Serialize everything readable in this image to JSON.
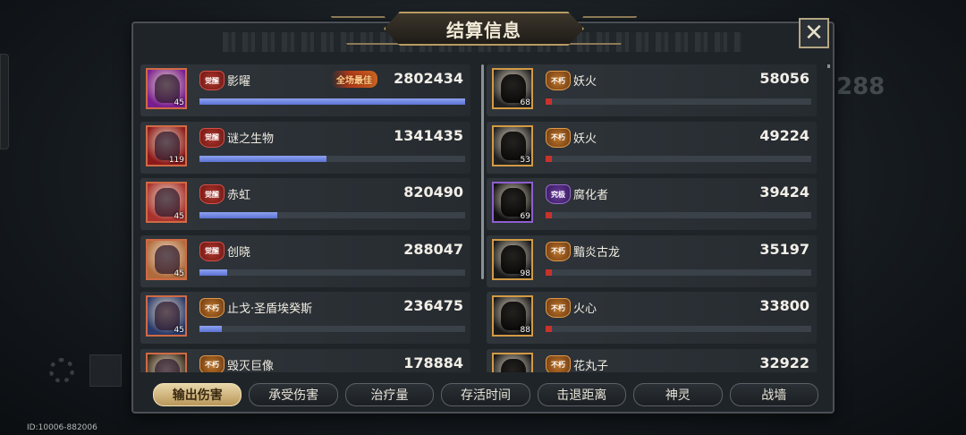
{
  "background": {
    "top_left_text": "",
    "top_right_text": "",
    "side_number": "288",
    "id_text": "ID:10006-882006"
  },
  "panel": {
    "title": "结算信息",
    "close_icon": "x-close-icon"
  },
  "colors": {
    "accent_gold": "#b89b63",
    "bar_blue": "#6f86e0",
    "bar_red": "#c8322d",
    "tab_active": "#d8bd84"
  },
  "left_team": [
    {
      "name": "影曜",
      "value": "2802434",
      "level": "45",
      "grade": "觉醒",
      "badge_color": "red",
      "avatar_color": "#7a1e8f",
      "mvp": "全场最佳",
      "share": 1.0
    },
    {
      "name": "谜之生物",
      "value": "1341435",
      "level": "119",
      "grade": "觉醒",
      "badge_color": "red",
      "avatar_color": "#8c1a1a",
      "mvp": "",
      "share": 0.4787
    },
    {
      "name": "赤虹",
      "value": "820490",
      "level": "45",
      "grade": "觉醒",
      "badge_color": "red",
      "avatar_color": "#a8322e",
      "mvp": "",
      "share": 0.2928
    },
    {
      "name": "创晓",
      "value": "288047",
      "level": "45",
      "grade": "觉醒",
      "badge_color": "red",
      "avatar_color": "#b06a3b",
      "mvp": "",
      "share": 0.1028
    },
    {
      "name": "止戈·圣盾埃癸斯",
      "value": "236475",
      "level": "45",
      "grade": "不朽",
      "badge_color": "gold",
      "avatar_color": "#2a3a6a",
      "mvp": "",
      "share": 0.0844
    },
    {
      "name": "毁灭巨像",
      "value": "178884",
      "level": "",
      "grade": "不朽",
      "badge_color": "gold",
      "avatar_color": "#3a2a1a",
      "mvp": "",
      "share": 0.0638
    }
  ],
  "right_team": [
    {
      "name": "妖火",
      "value": "58056",
      "level": "68",
      "grade": "不朽",
      "badge_color": "gold",
      "avatar_color": "#222",
      "share": 0.0207
    },
    {
      "name": "妖火",
      "value": "49224",
      "level": "53",
      "grade": "不朽",
      "badge_color": "gold",
      "avatar_color": "#222",
      "share": 0.0176
    },
    {
      "name": "腐化者",
      "value": "39424",
      "level": "69",
      "grade": "究极",
      "badge_color": "purple",
      "avatar_color": "#111",
      "share": 0.0141
    },
    {
      "name": "黯炎古龙",
      "value": "35197",
      "level": "98",
      "grade": "不朽",
      "badge_color": "gold",
      "avatar_color": "#1a1a1a",
      "share": 0.0126
    },
    {
      "name": "火心",
      "value": "33800",
      "level": "88",
      "grade": "不朽",
      "badge_color": "gold",
      "avatar_color": "#1a1a1a",
      "share": 0.0121
    },
    {
      "name": "花丸子",
      "value": "32922",
      "level": "",
      "grade": "不朽",
      "badge_color": "gold",
      "avatar_color": "#1a1a1a",
      "share": 0.0117
    }
  ],
  "tabs": [
    {
      "label": "输出伤害",
      "active": true
    },
    {
      "label": "承受伤害",
      "active": false
    },
    {
      "label": "治疗量",
      "active": false
    },
    {
      "label": "存活时间",
      "active": false
    },
    {
      "label": "击退距离",
      "active": false
    },
    {
      "label": "神灵",
      "active": false
    },
    {
      "label": "战墙",
      "active": false
    }
  ]
}
